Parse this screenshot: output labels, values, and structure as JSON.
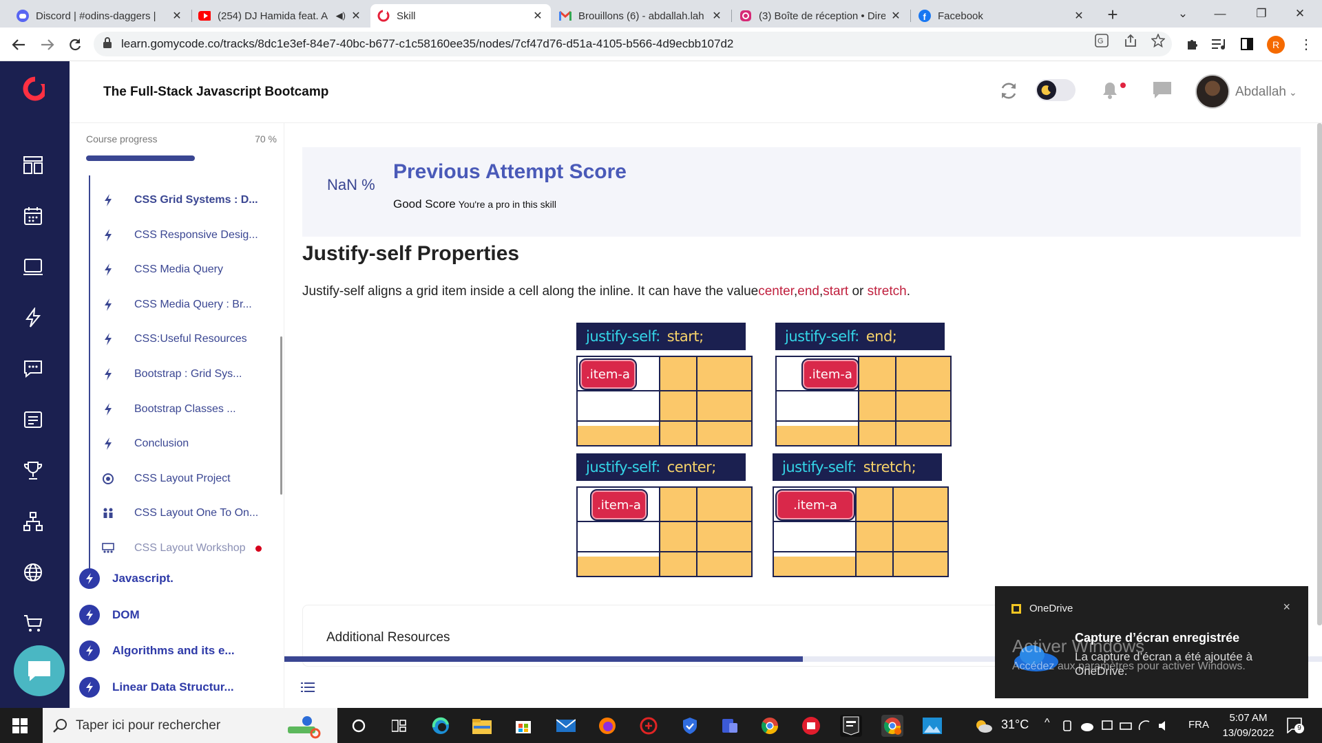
{
  "browser": {
    "tabs": [
      {
        "title": "Discord | #odins-daggers | ",
        "icon": "discord-icon",
        "active": false
      },
      {
        "title": "(254) DJ Hamida feat. A",
        "icon": "youtube-icon",
        "active": false
      },
      {
        "title": "Skill",
        "icon": "gomycode-icon",
        "active": true
      },
      {
        "title": "Brouillons (6) - abdallah.lah",
        "icon": "gmail-icon",
        "active": false
      },
      {
        "title": "(3) Boîte de réception • Dire",
        "icon": "instagram-icon",
        "active": false
      },
      {
        "title": "Facebook",
        "icon": "facebook-icon",
        "active": false
      }
    ],
    "new_tab": "+",
    "url": "learn.gomycode.co/tracks/8dc1e3ef-84e7-40bc-b677-c1c58160ee35/nodes/7cf47d76-d51a-4105-b566-4d9ecbb107d2",
    "profile_initial": "R"
  },
  "header": {
    "course_title": "The Full-Stack Javascript Bootcamp",
    "user_name": "Abdallah",
    "chevron": "⌄"
  },
  "outline": {
    "progress_label": "Course progress",
    "progress_value": "70 %",
    "progress_fraction": 0.58,
    "lessons": [
      {
        "label": "CSS Grid Systems : D...",
        "icon": "bolt-icon",
        "current": true
      },
      {
        "label": "CSS Responsive Desig...",
        "icon": "bolt-icon"
      },
      {
        "label": "CSS Media Query",
        "icon": "bolt-icon"
      },
      {
        "label": "CSS Media Query : Br...",
        "icon": "bolt-icon"
      },
      {
        "label": "CSS:Useful Resources",
        "icon": "bolt-icon"
      },
      {
        "label": "Bootstrap : Grid Sys...",
        "icon": "bolt-icon"
      },
      {
        "label": "Bootstrap Classes ...",
        "icon": "bolt-icon"
      },
      {
        "label": "Conclusion",
        "icon": "bolt-icon"
      },
      {
        "label": "CSS Layout Project",
        "icon": "target-icon"
      },
      {
        "label": "CSS Layout One To On...",
        "icon": "people-icon"
      },
      {
        "label": "CSS Layout Workshop",
        "icon": "workshop-icon",
        "locked": true
      }
    ],
    "modules": [
      {
        "label": "Javascript."
      },
      {
        "label": "DOM"
      },
      {
        "label": "Algorithms and its e..."
      },
      {
        "label": "Linear Data Structur..."
      }
    ]
  },
  "main": {
    "score_pct": "NaN %",
    "score_title": "Previous Attempt Score",
    "score_grade": "Good Score",
    "score_sub": "You're a pro in this skill",
    "heading": "Justify-self Properties",
    "intro": "Justify-self aligns a grid item inside a cell along the inline. It can have the value",
    "values": [
      "center",
      "end",
      "start",
      "stretch"
    ],
    "separator_or": "or",
    "period": ".",
    "diagram": {
      "property": "justify-self:",
      "panels": [
        {
          "value": "start;",
          "item": ".item-a"
        },
        {
          "value": "end;",
          "item": ".item-a"
        },
        {
          "value": "center;",
          "item": ".item-a"
        },
        {
          "value": "stretch;",
          "item": ".item-a"
        }
      ]
    },
    "resources_title": "Additional Resources"
  },
  "toast": {
    "app": "OneDrive",
    "close": "×",
    "title": "Capture d’écran enregistrée",
    "body": "La capture d’écran a été ajoutée à OneDrive.",
    "watermark_1": "Activer Windows",
    "watermark_2": "Accédez aux paramètres pour activer Windows."
  },
  "taskbar": {
    "search_placeholder": "Taper ici pour rechercher",
    "weather": "31°C",
    "language": "FRA",
    "time": "5:07 AM",
    "date": "13/09/2022",
    "notification_count": "9"
  },
  "colors": {
    "nav_bg": "#1b2050",
    "accent": "#3a4692",
    "score_title": "#4a5ab8",
    "keyword": "#c0203e",
    "cell": "#fbc86a",
    "item": "#d9284a"
  }
}
